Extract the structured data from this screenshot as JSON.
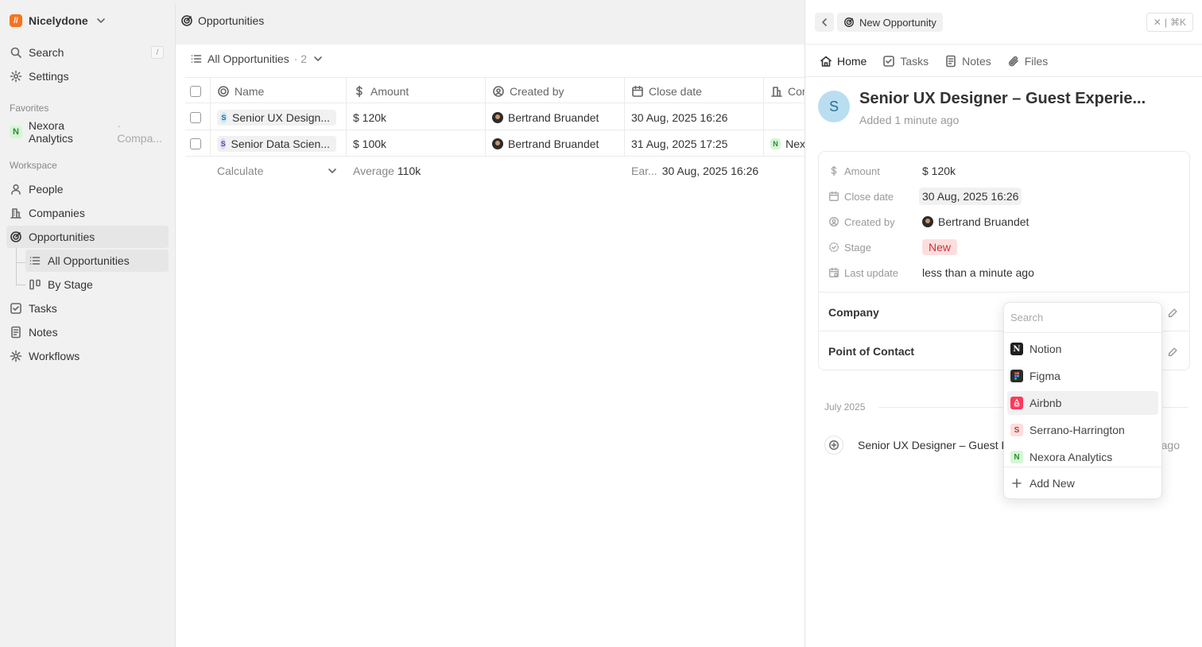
{
  "workspace": {
    "name": "Nicelydone"
  },
  "sidebar": {
    "search_label": "Search",
    "search_shortcut": "/",
    "settings_label": "Settings",
    "favorites_label": "Favorites",
    "favorite": {
      "name": "Nexora Analytics",
      "suffix": "· Compa...",
      "letter": "N"
    },
    "workspace_label": "Workspace",
    "items": [
      {
        "label": "People"
      },
      {
        "label": "Companies"
      },
      {
        "label": "Opportunities"
      },
      {
        "label": "All Opportunities"
      },
      {
        "label": "By Stage"
      },
      {
        "label": "Tasks"
      },
      {
        "label": "Notes"
      },
      {
        "label": "Workflows"
      }
    ]
  },
  "main": {
    "title": "Opportunities",
    "view": {
      "label": "All Opportunities",
      "count": "· 2"
    },
    "columns": [
      "Name",
      "Amount",
      "Created by",
      "Close date",
      "Cor"
    ],
    "rows": [
      {
        "letter": "S",
        "name": "Senior UX Design...",
        "amount": "$ 120k",
        "created_by": "Bertrand Bruandet",
        "close_date": "30 Aug, 2025 16:26",
        "company": ""
      },
      {
        "letter": "S",
        "name": "Senior Data Scien...",
        "amount": "$ 100k",
        "created_by": "Bertrand Bruandet",
        "close_date": "31 Aug, 2025 17:25",
        "company": "Nex",
        "company_letter": "N"
      }
    ],
    "calc": {
      "label": "Calculate",
      "avg_label": "Average",
      "avg_value": "110k",
      "earliest_label": "Ear...",
      "earliest_value": "30 Aug, 2025 16:26"
    }
  },
  "panel": {
    "crumb": "New Opportunity",
    "close_shortcut": "⌘K",
    "tabs": [
      "Home",
      "Tasks",
      "Notes",
      "Files"
    ],
    "record": {
      "letter": "S",
      "title": "Senior UX Designer – Guest Experie...",
      "added": "Added 1 minute ago"
    },
    "fields": {
      "amount_label": "Amount",
      "amount_value": "$ 120k",
      "close_label": "Close date",
      "close_value": "30 Aug, 2025 16:26",
      "created_label": "Created by",
      "created_value": "Bertrand Bruandet",
      "stage_label": "Stage",
      "stage_value": "New",
      "update_label": "Last update",
      "update_value": "less than a minute ago"
    },
    "relations": {
      "company": "Company",
      "contact": "Point of Contact"
    },
    "timeline": {
      "month": "July 2025",
      "event": "Senior UX Designer – Guest Ex",
      "time_suffix": "ago"
    }
  },
  "dropdown": {
    "search_placeholder": "Search",
    "items": [
      {
        "label": "Notion",
        "letter": "N",
        "bg": "#1f1f1f",
        "fg": "#ffffff"
      },
      {
        "label": "Figma",
        "letter": "F",
        "bg": "#2c2c2c",
        "fg": "#ffffff"
      },
      {
        "label": "Airbnb",
        "letter": "A",
        "bg": "#ff385c",
        "fg": "#ffffff"
      },
      {
        "label": "Serrano-Harrington",
        "letter": "S",
        "bg": "#fddede",
        "fg": "#c33333"
      },
      {
        "label": "Nexora Analytics",
        "letter": "N",
        "bg": "#d6f5d6",
        "fg": "#2f8a2f"
      }
    ],
    "add_new": "Add New"
  },
  "colors": {
    "brand": "#f5741f",
    "stage_new_bg": "#fddede",
    "stage_new_fg": "#cc3333"
  }
}
